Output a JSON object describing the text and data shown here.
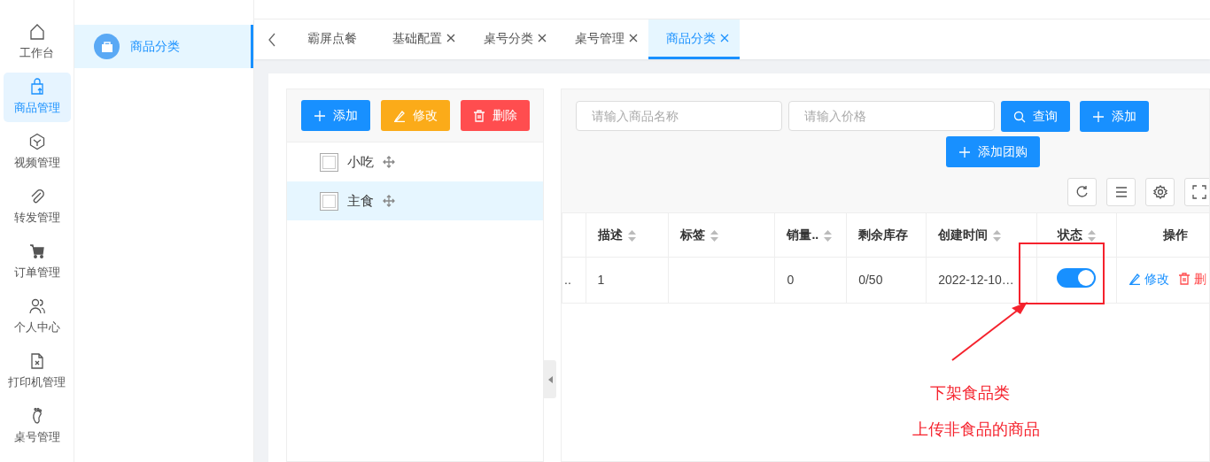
{
  "nav_rail": {
    "items": [
      {
        "label": "工作台",
        "kind": "home",
        "selected": false
      },
      {
        "label": "商品管理",
        "kind": "bag",
        "selected": true
      },
      {
        "label": "视频管理",
        "kind": "cube",
        "selected": false
      },
      {
        "label": "转发管理",
        "kind": "clip",
        "selected": false
      },
      {
        "label": "订单管理",
        "kind": "cart",
        "selected": false
      },
      {
        "label": "个人中心",
        "kind": "users",
        "selected": false
      },
      {
        "label": "打印机管理",
        "kind": "file",
        "selected": false
      },
      {
        "label": "桌号管理",
        "kind": "foot",
        "selected": false
      }
    ]
  },
  "submenu": {
    "items": [
      {
        "label": "商品分类",
        "selected": true
      }
    ]
  },
  "tabs": {
    "items": [
      {
        "label": "霸屏点餐",
        "closable": false,
        "selected": false
      },
      {
        "label": "基础配置",
        "closable": true,
        "selected": false
      },
      {
        "label": "桌号分类",
        "closable": true,
        "selected": false
      },
      {
        "label": "桌号管理",
        "closable": true,
        "selected": false
      },
      {
        "label": "商品分类",
        "closable": true,
        "selected": true
      }
    ]
  },
  "category_panel": {
    "buttons": [
      {
        "label": "添加",
        "kind": "add"
      },
      {
        "label": "修改",
        "kind": "edit"
      },
      {
        "label": "删除",
        "kind": "delete"
      }
    ],
    "items": [
      {
        "label": "小吃",
        "checked": false,
        "selected": false
      },
      {
        "label": "主食",
        "checked": false,
        "selected": true
      }
    ]
  },
  "product_panel": {
    "search_fields": [
      {
        "placeholder": "请输入商品名称"
      },
      {
        "placeholder": "请输入价格"
      }
    ],
    "buttons": [
      {
        "label": "查询",
        "kind": "search"
      },
      {
        "label": "添加",
        "kind": "add"
      },
      {
        "label": "添加团购",
        "kind": "add"
      }
    ],
    "table": {
      "columns": [
        {
          "label": "描述",
          "sortable": true
        },
        {
          "label": "标签",
          "sortable": true
        },
        {
          "label": "销量..",
          "sortable": true
        },
        {
          "label": "剩余库存",
          "sortable": false
        },
        {
          "label": "创建时间",
          "sortable": true
        },
        {
          "label": "状态",
          "sortable": true
        },
        {
          "label": "操作",
          "sortable": false
        }
      ],
      "rows": [
        {
          "column_1": "..",
          "description": "1",
          "sales": "0",
          "stock": "0/50",
          "created": "2022-12-10…",
          "status_on": true,
          "actions": [
            {
              "label": "修改",
              "kind": "edit"
            },
            {
              "label": "删",
              "kind": "delete"
            }
          ]
        }
      ]
    }
  },
  "annotation": {
    "lines": [
      "下架食品类",
      "上传非食品的商品"
    ]
  }
}
